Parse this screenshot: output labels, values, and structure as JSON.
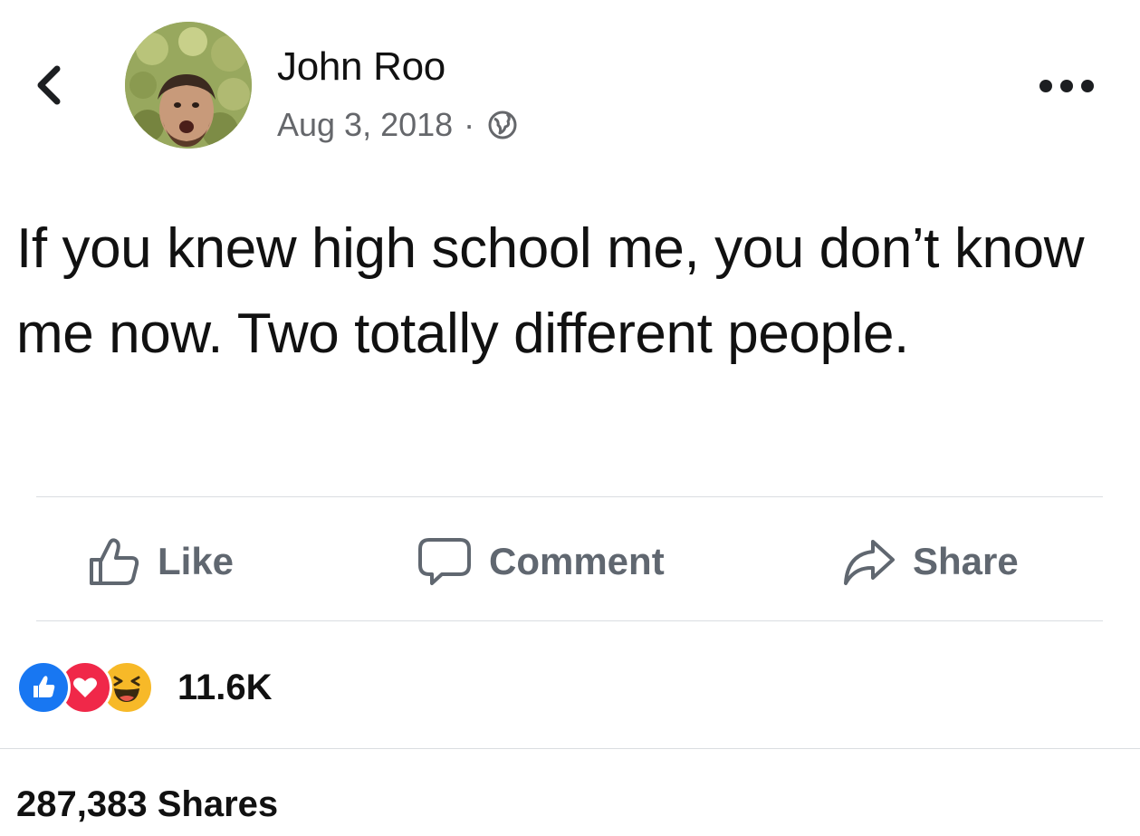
{
  "post": {
    "author": "John Roo",
    "date": "Aug 3, 2018",
    "separator": "·",
    "privacy_icon": "globe-icon",
    "text": "If you knew high school me, you don’t know me now. Two totally different people."
  },
  "header": {
    "back_icon": "chevron-left-icon",
    "more_icon": "ellipsis-icon"
  },
  "actions": {
    "like_label": "Like",
    "comment_label": "Comment",
    "share_label": "Share"
  },
  "engagement": {
    "reaction_icons": [
      "like-reaction-icon",
      "love-reaction-icon",
      "haha-reaction-icon"
    ],
    "reaction_count": "11.6K",
    "shares": "287,383 Shares"
  },
  "colors": {
    "like_blue": "#1877f2",
    "love_red": "#f02849",
    "haha_yellow": "#f7b928",
    "secondary_text": "#65676b",
    "action_text": "#606770",
    "divider": "#dadde1"
  }
}
